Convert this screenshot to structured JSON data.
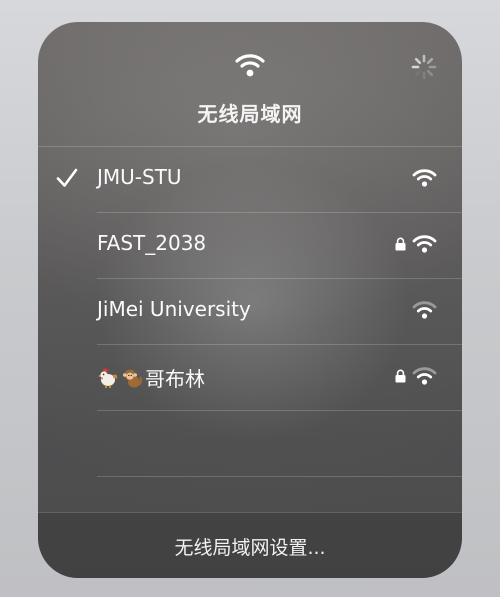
{
  "panel": {
    "title": "无线局域网",
    "header_icon": "wifi-icon",
    "status_icon": "loading-spinner-icon"
  },
  "networks": [
    {
      "name": "JMU-STU",
      "connected": true,
      "secured": false,
      "signal_icon": "wifi-signal-full-icon"
    },
    {
      "name": "FAST_2038",
      "connected": false,
      "secured": true,
      "signal_icon": "wifi-signal-full-icon"
    },
    {
      "name": "JiMei University",
      "connected": false,
      "secured": false,
      "signal_icon": "wifi-signal-weak-icon"
    },
    {
      "name": "哥布林",
      "prefix_emoji": [
        "rooster",
        "monkey"
      ],
      "connected": false,
      "secured": true,
      "signal_icon": "wifi-signal-weak-icon"
    }
  ],
  "footer": {
    "settings_label": "无线局域网设置..."
  },
  "colors": {
    "text": "#ffffff",
    "signal_dim": "#9a9a9a",
    "separator": "rgba(255,255,255,0.18)"
  }
}
